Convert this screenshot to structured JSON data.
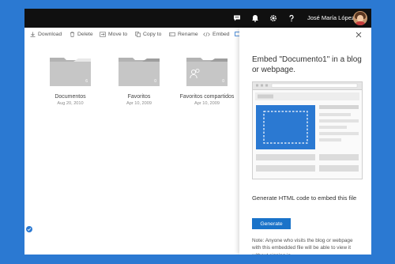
{
  "topbar": {
    "icons": [
      "feedback-icon",
      "notifications-icon",
      "settings-icon",
      "help-icon"
    ],
    "user_name": "José María López"
  },
  "commands": [
    {
      "label": "Download",
      "icon": "download-icon"
    },
    {
      "label": "Delete",
      "icon": "trash-icon"
    },
    {
      "label": "Move to",
      "icon": "move-icon"
    },
    {
      "label": "Copy to",
      "icon": "copy-icon"
    },
    {
      "label": "Rename",
      "icon": "rename-icon"
    },
    {
      "label": "Embed",
      "icon": "embed-icon"
    }
  ],
  "folders": [
    {
      "name": "Documentos",
      "date": "Aug 20, 2010",
      "count": "6"
    },
    {
      "name": "Favoritos",
      "date": "Apr 10, 2009",
      "count": "0"
    },
    {
      "name": "Favoritos compartidos",
      "date": "Apr 10, 2009",
      "count": "0"
    }
  ],
  "panel": {
    "title": "Embed \"Documento1\" in a blog or webpage.",
    "generate_text": "Generate HTML code to embed this file",
    "generate_label": "Generate",
    "note": "Note: Anyone who visits the blog or webpage with this embedded file will be able to view it without signing in."
  },
  "colors": {
    "background": "#2b79d2",
    "topbar": "#101010",
    "accent": "#1a73c9",
    "folder": "#c6c6c6"
  }
}
